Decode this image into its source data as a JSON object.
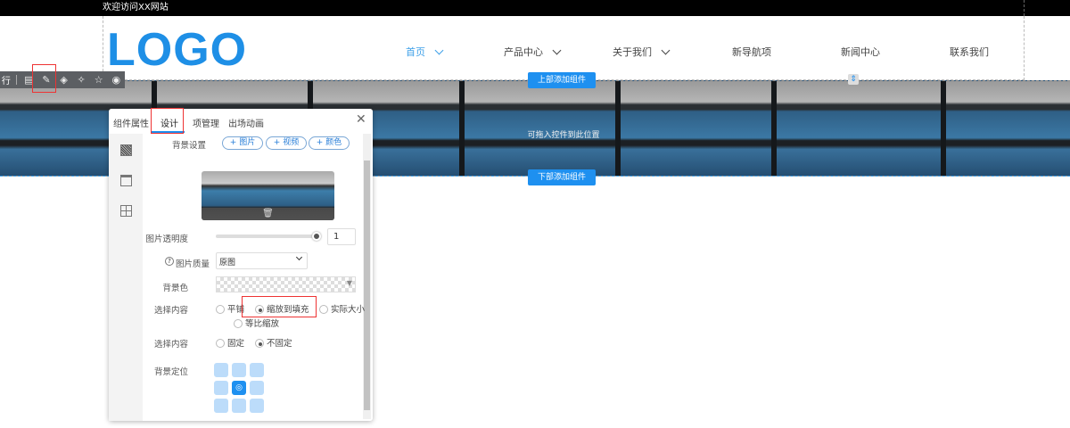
{
  "topbar": {
    "welcome": "欢迎访问XX网站"
  },
  "header": {
    "logo": "LOGO",
    "nav": [
      {
        "label": "首页",
        "has_dropdown": true,
        "active": true
      },
      {
        "label": "产品中心",
        "has_dropdown": true
      },
      {
        "label": "关于我们",
        "has_dropdown": true
      },
      {
        "label": "新导航项"
      },
      {
        "label": "新闻中心"
      },
      {
        "label": "联系我们"
      }
    ]
  },
  "canvas": {
    "add_top": "上部添加组件",
    "drop_hint": "可拖入控件到此位置",
    "add_bottom": "下部添加组件"
  },
  "toolbar": {
    "row_label": "行",
    "icons": [
      "edit-icon",
      "design-icon",
      "layers-icon",
      "magic-icon",
      "star-icon",
      "eye-icon"
    ]
  },
  "panel": {
    "tabs": [
      "组件属性",
      "设计",
      "项管理",
      "出场动画"
    ],
    "active_tab": "设计",
    "bg_label": "背景设置",
    "bg_buttons": [
      "+ 图片",
      "+ 视频",
      "+ 颜色"
    ],
    "opacity_label": "图片透明度",
    "opacity_value": "1",
    "opacity": 1,
    "quality_label": "图片质量",
    "quality_value": "原图",
    "bgcolor_label": "背景色",
    "fit_label": "选择内容",
    "fit_options": [
      "平铺",
      "缩放到填充",
      "实际大小",
      "等比缩放"
    ],
    "fit_selected": "缩放到填充",
    "attach_label": "选择内容",
    "attach_options": [
      "固定",
      "不固定"
    ],
    "attach_selected": "不固定",
    "position_label": "背景定位",
    "position_selected": "center"
  },
  "colors": {
    "accent": "#1e90f0",
    "highlight": "#e33333"
  }
}
